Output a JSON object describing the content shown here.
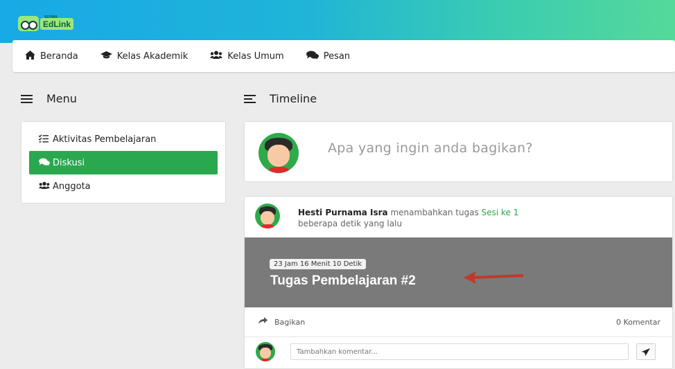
{
  "brand": {
    "name": "EdLink",
    "tagline": "SEVIMA"
  },
  "nav": [
    {
      "label": "Beranda",
      "icon": "home-icon"
    },
    {
      "label": "Kelas Akademik",
      "icon": "graduation-cap-icon"
    },
    {
      "label": "Kelas Umum",
      "icon": "users-icon"
    },
    {
      "label": "Pesan",
      "icon": "comments-icon"
    }
  ],
  "sidebar": {
    "title": "Menu",
    "items": [
      {
        "label": "Aktivitas Pembelajaran",
        "icon": "list-check-icon",
        "active": false
      },
      {
        "label": "Diskusi",
        "icon": "comments-icon",
        "active": true
      },
      {
        "label": "Anggota",
        "icon": "users-icon",
        "active": false
      }
    ]
  },
  "timeline": {
    "title": "Timeline",
    "post_placeholder": "Apa yang ingin anda bagikan?"
  },
  "feed_item": {
    "author": "Hesti Purnama Isra",
    "action": "menambahkan tugas",
    "session": "Sesi ke 1",
    "time": "beberapa detik yang lalu",
    "countdown": "23 Jam 16 Menit 10 Detik",
    "task_title": "Tugas Pembelajaran #2",
    "share_label": "Bagikan",
    "comments_label": "0 Komentar",
    "comment_placeholder": "Tambahkan komentar..."
  },
  "colors": {
    "accent_green": "#2aa84f",
    "header_gradient_start": "#18a9e6",
    "header_gradient_end": "#55d99a",
    "banner_gray": "#7a7a7a",
    "arrow_red": "#c0392b"
  }
}
